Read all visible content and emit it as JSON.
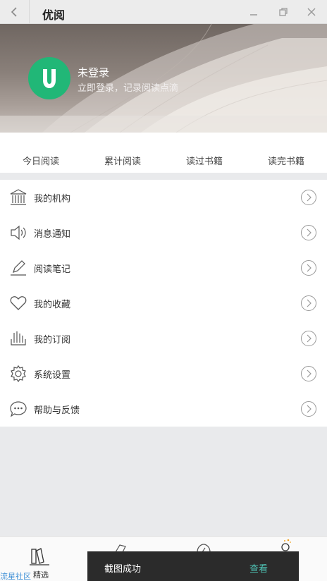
{
  "window": {
    "title": "优阅"
  },
  "hero": {
    "title": "未登录",
    "subtitle": "立即登录，记录阅读点滴"
  },
  "stats": [
    {
      "label": "今日阅读"
    },
    {
      "label": "累计阅读"
    },
    {
      "label": "读过书籍"
    },
    {
      "label": "读完书籍"
    }
  ],
  "menu": [
    {
      "label": "我的机构",
      "icon": "institution-icon"
    },
    {
      "label": "消息通知",
      "icon": "speaker-icon"
    },
    {
      "label": "阅读笔记",
      "icon": "pen-icon"
    },
    {
      "label": "我的收藏",
      "icon": "heart-icon"
    },
    {
      "label": "我的订阅",
      "icon": "subscribe-icon"
    },
    {
      "label": "系统设置",
      "icon": "gear-icon"
    },
    {
      "label": "帮助与反馈",
      "icon": "chat-bubble-icon"
    }
  ],
  "bottom_nav": {
    "featured_label": "精选"
  },
  "toast": {
    "message": "截图成功",
    "action": "查看"
  },
  "watermark": "流星社区",
  "colors": {
    "brand_green": "#21b777",
    "toast_bg": "#2b2b2b",
    "toast_action": "#4fc3b5"
  }
}
